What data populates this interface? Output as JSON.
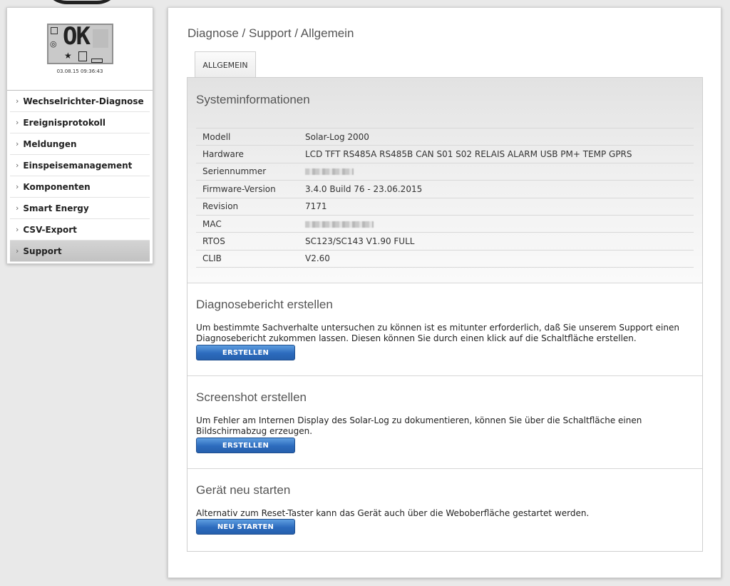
{
  "lcd": {
    "status_text": "OK",
    "timestamp": "03.08.15 09:36:43"
  },
  "sidebar": {
    "items": [
      {
        "label": "Wechselrichter-Diagnose"
      },
      {
        "label": "Ereignisprotokoll"
      },
      {
        "label": "Meldungen"
      },
      {
        "label": "Einspeisemanagement"
      },
      {
        "label": "Komponenten"
      },
      {
        "label": "Smart Energy"
      },
      {
        "label": "CSV-Export"
      },
      {
        "label": "Support",
        "active": true
      }
    ]
  },
  "breadcrumb": "Diagnose / Support / Allgemein",
  "tab": {
    "label": "ALLGEMEIN"
  },
  "sysinfo": {
    "title": "Systeminformationen",
    "rows": [
      {
        "key": "Modell",
        "value": "Solar-Log 2000"
      },
      {
        "key": "Hardware",
        "value": "LCD TFT RS485A RS485B CAN S01 S02 RELAIS ALARM USB PM+ TEMP GPRS"
      },
      {
        "key": "Seriennummer",
        "value": ""
      },
      {
        "key": "Firmware-Version",
        "value": "3.4.0 Build 76 - 23.06.2015"
      },
      {
        "key": "Revision",
        "value": "7171"
      },
      {
        "key": "MAC",
        "value": ""
      },
      {
        "key": "RTOS",
        "value": "SC123/SC143 V1.90 FULL"
      },
      {
        "key": "CLIB",
        "value": "V2.60"
      }
    ]
  },
  "diagnose": {
    "title": "Diagnosebericht erstellen",
    "text": "Um bestimmte Sachverhalte untersuchen zu können ist es mitunter erforderlich, daß Sie unserem Support einen Diagnosebericht zukommen lassen. Diesen können Sie durch einen klick auf die Schaltfläche erstellen.",
    "button": "ERSTELLEN"
  },
  "screenshot": {
    "title": "Screenshot erstellen",
    "text": "Um Fehler am Internen Display des Solar-Log zu dokumentieren, können Sie über die Schaltfläche einen Bildschirmabzug erzeugen.",
    "button": "ERSTELLEN"
  },
  "restart": {
    "title": "Gerät neu starten",
    "text": "Alternativ zum Reset-Taster kann das Gerät auch über die Weboberfläche gestartet werden.",
    "button": "NEU STARTEN"
  }
}
